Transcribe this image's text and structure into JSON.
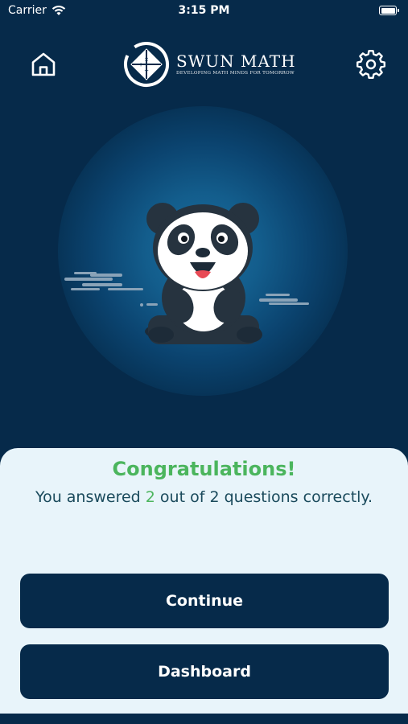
{
  "status_bar": {
    "carrier": "Carrier",
    "time": "3:15 PM",
    "battery_level": 1.0
  },
  "header": {
    "home_icon": "home-icon",
    "settings_icon": "gear-icon",
    "logo": {
      "title": "SWUN MATH",
      "tagline": "DEVELOPING MATH MINDS FOR TOMORROW"
    }
  },
  "illustration": {
    "name": "panda-mascot"
  },
  "result": {
    "title": "Congratulations!",
    "prefix": "You answered",
    "correct": "2",
    "middle": "out of",
    "total": "2",
    "suffix": "questions correctly."
  },
  "buttons": {
    "continue_label": "Continue",
    "dashboard_label": "Dashboard"
  },
  "colors": {
    "background": "#062a4a",
    "accent_green": "#4bb55d",
    "card": "#e8f4fa",
    "text_dark": "#1a4a5c"
  }
}
